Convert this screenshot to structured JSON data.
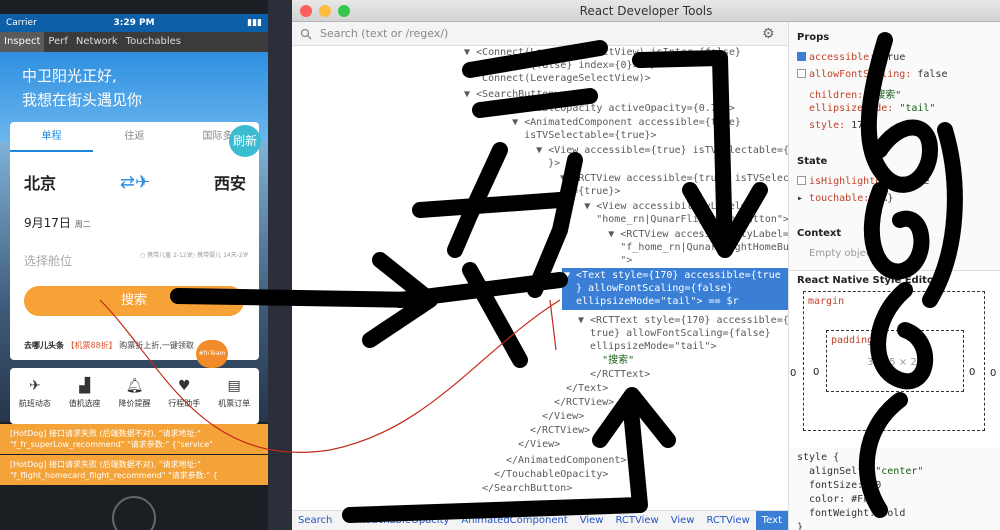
{
  "phone": {
    "status": {
      "carrier": "Carrier",
      "time": "3:29 PM",
      "battery": "▮▮▮"
    },
    "inspector_tabs": [
      "Inspect",
      "Perf",
      "Network",
      "Touchables"
    ],
    "banner": {
      "line1": "中卫阳光正好,",
      "line2": "我想在街头遇见你"
    },
    "trip_tabs": [
      "单程",
      "往返",
      "国际多"
    ],
    "refresh": "刷新",
    "from": "北京",
    "to": "西安",
    "date": "9月17日",
    "weekday": "周二",
    "cabin_placeholder": "选择舱位",
    "child_opt": "携带儿童\n2-12岁",
    "infant_opt": "携带婴儿\n14天-2岁",
    "search_btn": "搜索",
    "news": {
      "source": "去哪儿头条",
      "tag": "【机票88折】",
      "text": "购票折上折,一键领取"
    },
    "fn_badge": "#fnTeam",
    "tools": [
      "航班动态",
      "值机选座",
      "降价提醒",
      "行程助手",
      "机票订单"
    ],
    "hotdog": [
      "[HotDog] 接口请求失败 (后端数据不对), \"请求地址:\"",
      "\"f_fr_superLow_recommend\" \"请求参数:\" {\"service\"",
      "[HotDog] 接口请求失败 (后端数据不对), \"请求地址:\"",
      "\"f_flight_homecard_flight_recommend\" \"请求参数:\" {"
    ]
  },
  "devtools": {
    "title": "React Developer Tools",
    "search_placeholder": "Search (text or /regex/)",
    "tree_lines": [
      "▼ <Connect(LeverageSelectView) isInter={false}",
      "   isRound={false} index={0}>…</",
      "   Connect(LeverageSelectView)>",
      "▼ <SearchButton>",
      "  ▼ <TouchableOpacity activeOpacity={0.75}>",
      "    ▼ <AnimatedComponent accessible={true}",
      "      isTVSelectable={true}>",
      "      ▼ <View accessible={true} isTVSelectable={true",
      "        }>",
      "        ▼ <RCTView accessible={true} isTVSelectable",
      "          ={true}>",
      "          ▼ <View accessibilityLabel=",
      "            \"home_rn|QunarFlightHomeButton\">",
      "            ▼ <RCTView accessibilityLabel=",
      "              \"f_home_rn|QunarFlightHomeButtonSearch",
      "              \">"
    ],
    "selected_lines": [
      "▼ <Text style={170} accessible={true",
      "  } allowFontScaling={false}",
      "  ellipsizeMode=\"tail\"> == $r"
    ],
    "tree_after": [
      "▼ <RCTText style={170} accessible={",
      "  true} allowFontScaling={false}",
      "  ellipsizeMode=\"tail\">",
      "    \"搜索\"",
      "  </RCTText>",
      "</Text>",
      "</RCTView>",
      "</View>",
      "</RCTView>",
      "</View>",
      "</AnimatedComponent>",
      "</TouchableOpacity>",
      "</SearchButton>"
    ],
    "breadcrumbs": [
      "Search",
      "TouchableOpacity",
      "AnimatedComponent",
      "View",
      "RCTView",
      "View",
      "RCTView",
      "Text"
    ],
    "props_header": "Props",
    "props": [
      {
        "key": "accessible",
        "value": "true",
        "checkbox": true
      },
      {
        "key": "allowFontScaling",
        "value": "false",
        "checkbox": true
      },
      {
        "key": "children",
        "value": "\"搜索\""
      },
      {
        "key": "ellipsizeMode",
        "value": "\"tail\""
      },
      {
        "key": "style",
        "value": "170"
      }
    ],
    "state_header": "State",
    "state": [
      {
        "key": "isHighlighted",
        "value": "false",
        "checkbox": true
      },
      {
        "key": "touchable",
        "value": "{…}"
      }
    ],
    "context_header": "Context",
    "context_empty": "Empty object",
    "rn_style_header": "React Native Style Editor",
    "margin_label": "margin",
    "padding_label": "padding",
    "box_values": {
      "m_left": "0",
      "m_right": "0",
      "p_left": "0",
      "p_right": "0",
      "size": "395.5 × 21"
    },
    "style_open": "style {",
    "style_props": [
      {
        "key": "alignSelf",
        "value": "\"center\""
      },
      {
        "key": "fontSize",
        "value": "20"
      },
      {
        "key": "color",
        "value": "#FFF"
      },
      {
        "key": "fontWeight",
        "value": "bold"
      }
    ],
    "style_close": "}"
  },
  "colors": {
    "accent": "#3a7fd5",
    "orange": "#f7a236",
    "banner_blue": "#2f8fe0"
  }
}
